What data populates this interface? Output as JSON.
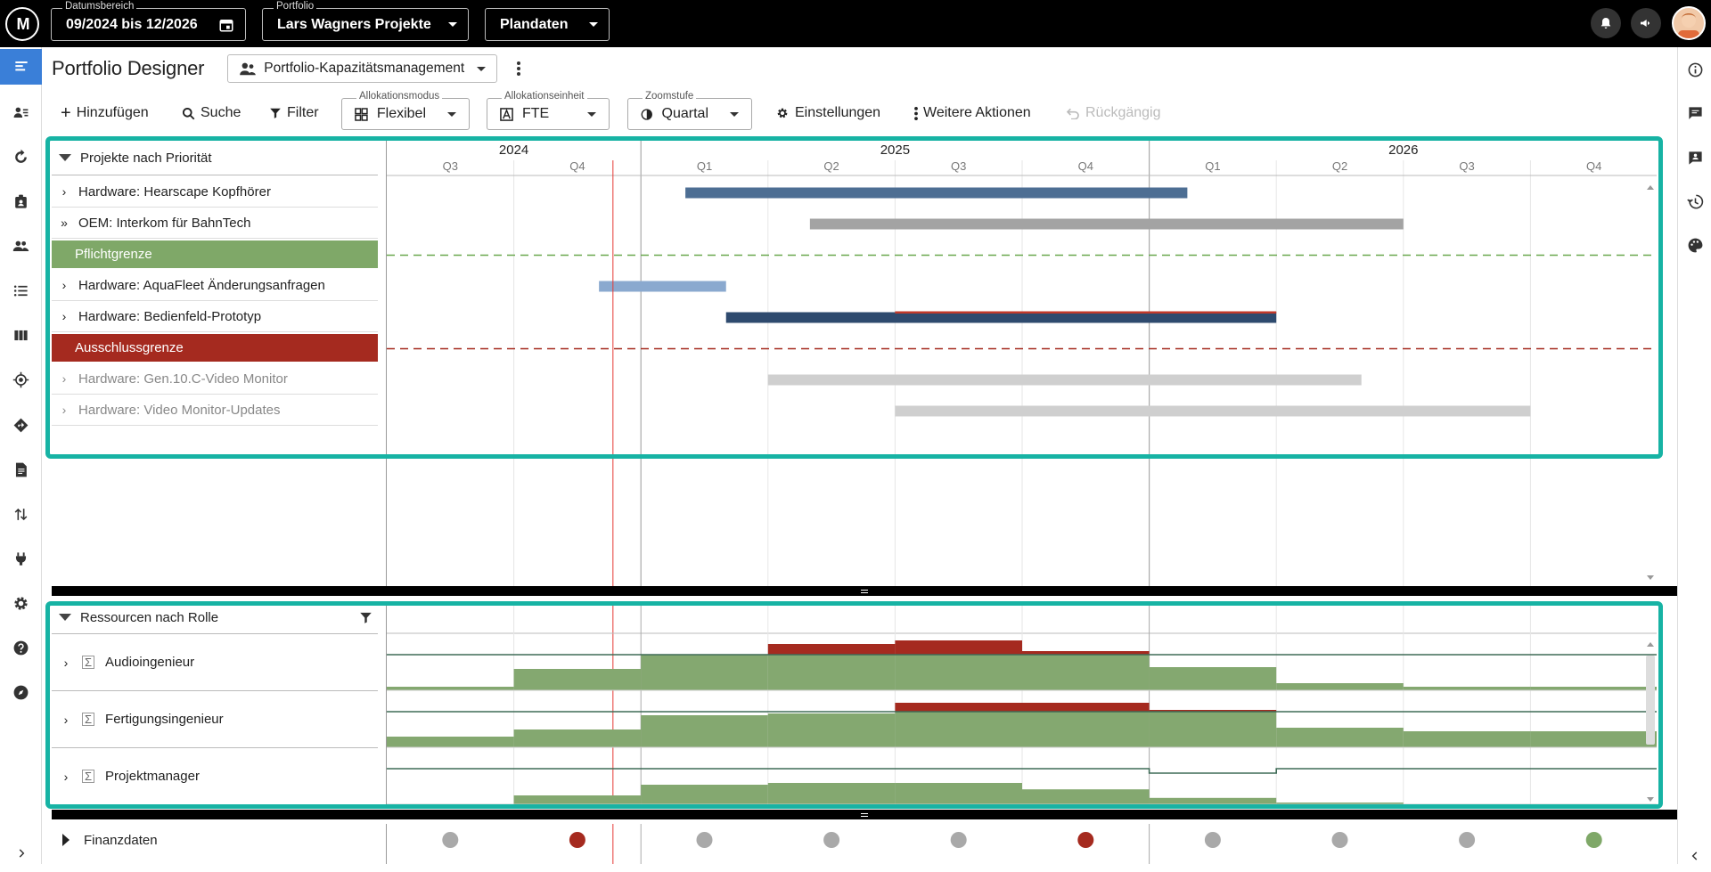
{
  "topbar": {
    "logo_text": "M",
    "date_range": {
      "label": "Datumsbereich",
      "value": "09/2024 bis 12/2026"
    },
    "portfolio": {
      "label": "Portfolio",
      "value": "Lars Wagners Projekte"
    },
    "data_mode": {
      "value": "Plandaten"
    }
  },
  "page": {
    "title": "Portfolio Designer",
    "view_selector": "Portfolio-Kapazitätsmanagement"
  },
  "toolbar": {
    "add": "Hinzufügen",
    "search": "Suche",
    "filter": "Filter",
    "allocation_mode": {
      "label": "Allokationsmodus",
      "value": "Flexibel"
    },
    "allocation_unit": {
      "label": "Allokationseinheit",
      "value": "FTE"
    },
    "zoom": {
      "label": "Zoomstufe",
      "value": "Quartal"
    },
    "settings": "Einstellungen",
    "more_actions": "Weitere Aktionen",
    "undo": "Rückgängig"
  },
  "timeline": {
    "years": [
      "2024",
      "2025",
      "2026"
    ],
    "quarters": [
      "Q3",
      "Q4",
      "Q1",
      "Q2",
      "Q3",
      "Q4",
      "Q1",
      "Q2",
      "Q3",
      "Q4"
    ]
  },
  "projects": {
    "group_label": "Projekte nach Priorität",
    "rows": [
      {
        "kind": "project",
        "label": "Hardware: Hearscape Kopfhörer",
        "expander": "›",
        "dim": false,
        "bar": {
          "start": 2.35,
          "end": 6.3,
          "color": "#4d6e93"
        }
      },
      {
        "kind": "project",
        "label": "OEM: Interkom für BahnTech",
        "expander": "»",
        "dim": false,
        "bar": {
          "start": 3.33,
          "end": 8.0,
          "color": "#a3a3a3"
        }
      },
      {
        "kind": "band",
        "label": "Pflichtgrenze",
        "color": "#7fa868",
        "line": "#6aa84f"
      },
      {
        "kind": "project",
        "label": "Hardware: AquaFleet Änderungsanfragen",
        "expander": "›",
        "dim": false,
        "bar": {
          "start": 1.67,
          "end": 2.67,
          "color": "#8aa9cf"
        }
      },
      {
        "kind": "project",
        "label": "Hardware: Bedienfeld-Prototyp",
        "expander": "›",
        "dim": false,
        "bar": {
          "start": 2.67,
          "end": 7.0,
          "color": "#2e4a6e",
          "over_start": 4.0,
          "over_color": "#c0392b"
        }
      },
      {
        "kind": "band",
        "label": "Ausschlussgrenze",
        "color": "#a52a1f",
        "line": "#a52a1f"
      },
      {
        "kind": "project",
        "label": "Hardware: Gen.10.C-Video Monitor",
        "expander": "›",
        "dim": true,
        "bar": {
          "start": 3.0,
          "end": 7.67,
          "color": "#cfcfcf"
        }
      },
      {
        "kind": "project",
        "label": "Hardware: Video Monitor-Updates",
        "expander": "›",
        "dim": true,
        "bar": {
          "start": 4.0,
          "end": 9.0,
          "color": "#cfcfcf"
        }
      }
    ]
  },
  "resources": {
    "group_label": "Ressourcen nach Rolle",
    "rows": [
      {
        "label": "Audioingenieur",
        "capacity": 1.0,
        "demand": [
          0.1,
          0.6,
          1.0,
          1.0,
          1.0,
          1.0,
          0.65,
          0.2,
          0.1,
          0.1
        ],
        "over": [
          0,
          0,
          0,
          0.3,
          0.4,
          0.1,
          0,
          0,
          0,
          0
        ]
      },
      {
        "label": "Fertigungsingenieur",
        "capacity": 1.0,
        "demand": [
          0.3,
          0.5,
          0.9,
          0.95,
          1.0,
          1.0,
          1.0,
          0.55,
          0.45,
          0.45
        ],
        "over": [
          0,
          0,
          0,
          0,
          0.25,
          0.25,
          0.05,
          0,
          0,
          0
        ]
      },
      {
        "label": "Projektmanager",
        "capacity": 1.0,
        "demand": [
          0,
          0.25,
          0.55,
          0.6,
          0.6,
          0.42,
          0.18,
          0.05,
          0,
          0
        ],
        "capacity_dip": [
          6,
          7
        ]
      }
    ]
  },
  "finance": {
    "label": "Finanzdaten",
    "status_colors": [
      "#a9a9a9",
      "#a52a1f",
      "#a9a9a9",
      "#a9a9a9",
      "#a9a9a9",
      "#a52a1f",
      "#a9a9a9",
      "#a9a9a9",
      "#a9a9a9",
      "#7fa868"
    ]
  },
  "colors": {
    "accent": "#17b3a4",
    "nav_active": "#3a7fd8",
    "today_line": "#e53935",
    "demand_ok": "#84a870",
    "demand_over": "#a52a1f"
  },
  "icons": {
    "left_nav": [
      "list-icon",
      "user-list-icon",
      "refresh-icon",
      "badge-icon",
      "people-icon",
      "bullet-list-icon",
      "columns-icon",
      "target-icon",
      "direction-icon",
      "document-icon",
      "swap-icon",
      "plug-icon",
      "gear-icon",
      "help-icon",
      "compass-icon"
    ],
    "right_nav": [
      "info-icon",
      "chat-icon",
      "comment-icon",
      "history-icon",
      "palette-icon"
    ]
  }
}
